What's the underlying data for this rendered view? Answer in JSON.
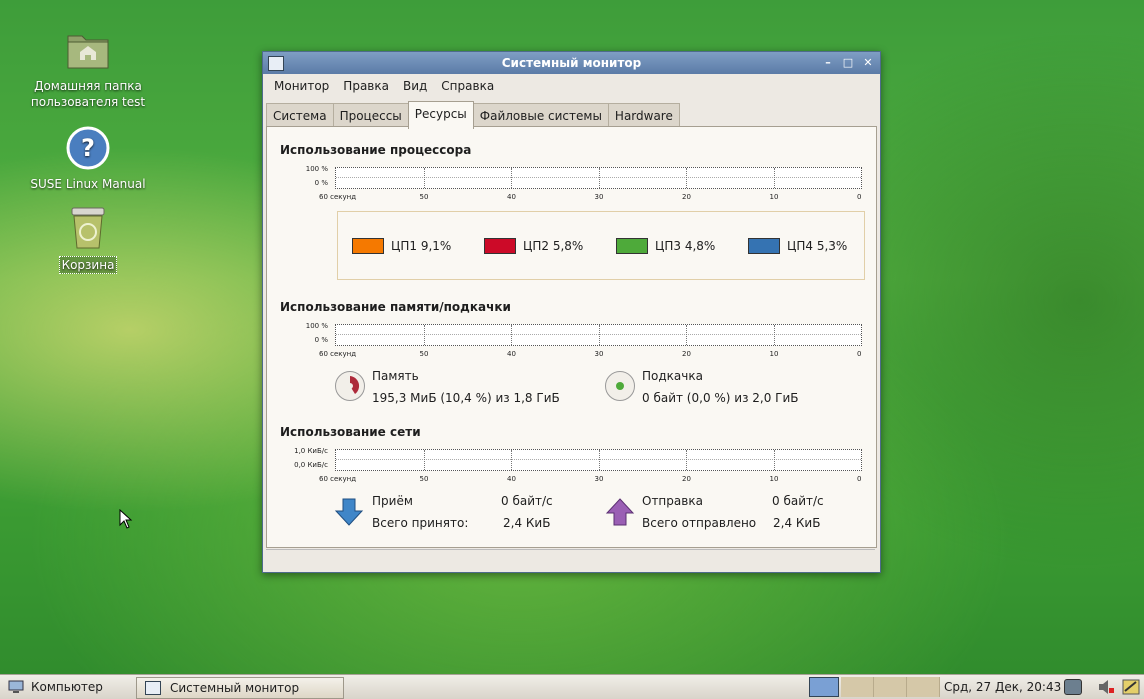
{
  "desktop": {
    "icons": [
      {
        "label_line1": "Домашняя папка",
        "label_line2": "пользователя test",
        "icon": "home-folder-icon"
      },
      {
        "label": "SUSE Linux Manual",
        "icon": "help-icon"
      },
      {
        "label": "Корзина",
        "icon": "trash-icon"
      }
    ]
  },
  "window": {
    "title": "Системный монитор",
    "menus": [
      "Монитор",
      "Правка",
      "Вид",
      "Справка"
    ],
    "tabs": [
      "Система",
      "Процессы",
      "Ресурсы",
      "Файловые системы",
      "Hardware"
    ],
    "active_tab": "Ресурсы"
  },
  "resources": {
    "cpu": {
      "title": "Использование процессора",
      "y_labels": [
        "100 %",
        "0 %"
      ],
      "x_labels": [
        "60 секунд",
        "50",
        "40",
        "30",
        "20",
        "10",
        "0"
      ],
      "cores": [
        {
          "label": "ЦП1",
          "value": "9,1%",
          "color": "#f57900"
        },
        {
          "label": "ЦП2",
          "value": "5,8%",
          "color": "#cc0a28"
        },
        {
          "label": "ЦП3",
          "value": "4,8%",
          "color": "#4eaa3a"
        },
        {
          "label": "ЦП4",
          "value": "5,3%",
          "color": "#3573b2"
        }
      ]
    },
    "memory": {
      "title": "Использование памяти/подкачки",
      "y_labels": [
        "100 %",
        "0 %"
      ],
      "x_labels": [
        "60 секунд",
        "50",
        "40",
        "30",
        "20",
        "10",
        "0"
      ],
      "mem_label": "Память",
      "mem_value": "195,3 МиБ (10,4 %) из 1,8 ГиБ",
      "mem_color": "#ad2a3a",
      "swap_label": "Подкачка",
      "swap_value": "0 байт (0,0 %) из 2,0 ГиБ",
      "swap_color": "#4eaa3a"
    },
    "network": {
      "title": "Использование сети",
      "y_labels": [
        "1,0 КиБ/с",
        "0,0 КиБ/с"
      ],
      "x_labels": [
        "60 секунд",
        "50",
        "40",
        "30",
        "20",
        "10",
        "0"
      ],
      "rx_label": "Приём",
      "rx_rate": "0 байт/с",
      "rx_total_label": "Всего принято:",
      "rx_total": "2,4 КиБ",
      "tx_label": "Отправка",
      "tx_rate": "0 байт/с",
      "tx_total_label": "Всего отправлено",
      "tx_total": "2,4 КиБ"
    }
  },
  "taskbar": {
    "computer_label": "Компьютер",
    "task_label": "Системный монитор",
    "clock": "Срд, 27 Дек, 20:43"
  }
}
